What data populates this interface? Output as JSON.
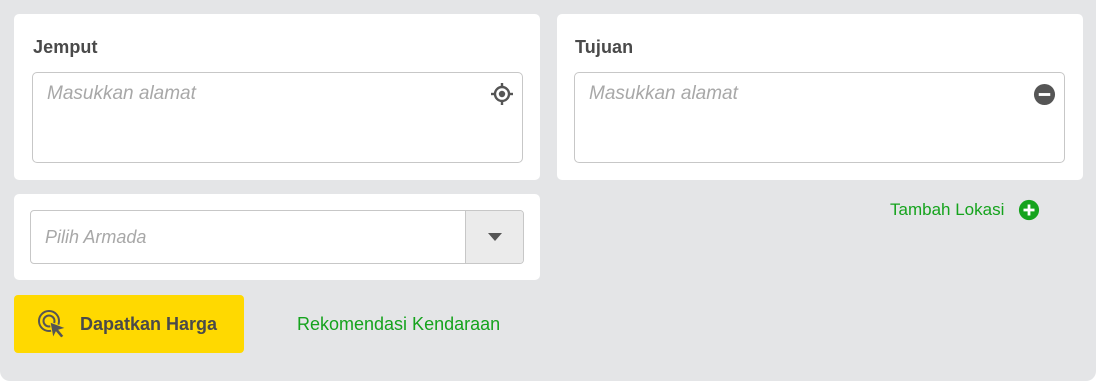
{
  "pickup": {
    "label": "Jemput",
    "placeholder": "Masukkan alamat",
    "value": ""
  },
  "destination": {
    "label": "Tujuan",
    "placeholder": "Masukkan alamat",
    "value": ""
  },
  "fleet": {
    "placeholder": "Pilih Armada"
  },
  "add_location": {
    "label": "Tambah Lokasi"
  },
  "actions": {
    "get_price_label": "Dapatkan Harga",
    "recommendation_label": "Rekomendasi Kendaraan"
  },
  "icons": {
    "pickup_locate": "crosshair-location-icon",
    "destination_remove": "minus-circle-icon",
    "add_location": "plus-circle-icon",
    "fleet_dropdown": "caret-down-icon",
    "get_price": "cursor-click-icon"
  },
  "colors": {
    "accent_green": "#15a31d",
    "button_yellow": "#ffd900",
    "background": "#e4e5e7"
  }
}
